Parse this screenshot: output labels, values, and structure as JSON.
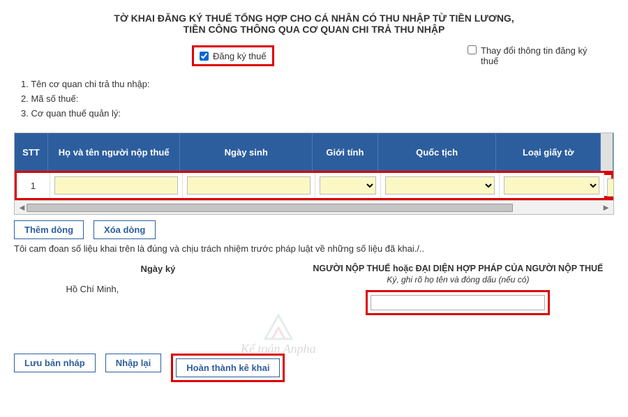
{
  "header": {
    "line1": "TỜ KHAI ĐĂNG KÝ THUẾ TỔNG HỢP CHO CÁ NHÂN CÓ THU NHẬP TỪ TIỀN LƯƠNG,",
    "line2": "TIỀN CÔNG THÔNG QUA CƠ QUAN CHI TRẢ THU NHẬP"
  },
  "checkboxes": {
    "register_label": "Đăng ký thuế",
    "register_checked": true,
    "change_label": "Thay đổi thông tin đăng ký thuế",
    "change_checked": false
  },
  "info": {
    "line1": "1. Tên cơ quan chi trả thu nhập:",
    "line2": "2. Mã số thuế:",
    "line3": "3. Cơ quan thuế quản lý:"
  },
  "table": {
    "headers": {
      "stt": "STT",
      "name": "Họ và tên người nộp thuế",
      "dob": "Ngày sinh",
      "gender": "Giới tính",
      "nation": "Quốc tịch",
      "doc": "Loại giấy tờ"
    },
    "row": {
      "stt": "1",
      "name": "",
      "dob": "",
      "gender": "",
      "nation": "",
      "doc": ""
    }
  },
  "buttons": {
    "add_row": "Thêm dòng",
    "del_row": "Xóa dòng",
    "save_draft": "Lưu bản nháp",
    "reset": "Nhập lại",
    "complete": "Hoàn thành kê khai"
  },
  "commitment": "Tôi cam đoan số liệu khai trên là đúng và chịu trách nhiệm trước pháp luật về những số liệu đã khai./..",
  "sign": {
    "date_label": "Ngày ký",
    "city": "Hồ Chí Minh,",
    "date_value": "",
    "rep_title": "NGƯỜI NỘP THUẾ hoặc ĐẠI DIỆN HỢP PHÁP CỦA NGƯỜI NỘP THUẾ",
    "rep_sub": "Ký, ghi rõ họ tên và đóng dấu (nếu có)",
    "rep_value": ""
  },
  "watermark": "Kế toán Anpha"
}
